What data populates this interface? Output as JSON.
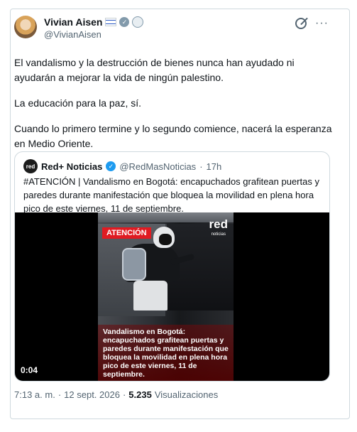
{
  "author": {
    "name": "Vivian Aisen",
    "handle": "@VivianAisen"
  },
  "tweet": {
    "paragraphs": [
      "El vandalismo y la destrucción de bienes nunca han ayudado ni ayudarán a mejorar la vida de ningún palestino.",
      "La educación para la paz, sí.",
      "Cuando lo primero termine y lo segundo comience, nacerá la esperanza en Medio Oriente."
    ]
  },
  "quote": {
    "logo_text": "red",
    "name": "Red+ Noticias",
    "handle": "@RedMasNoticias",
    "separator": "·",
    "time": "17h",
    "text": "#ATENCIÓN | Vandalismo en Bogotá: encapuchados grafitean puertas y paredes durante manifestación que bloquea la movilidad en plena hora pico de este viernes, 11 de septiembre.",
    "video": {
      "badge": "ATENCIÓN",
      "brand": "red",
      "brand_sub": "noticias",
      "caption": "Vandalismo en Bogotá: encapuchados grafitean puertas y paredes durante manifestación que bloquea la movilidad en plena hora pico de este viernes, 11 de septiembre.",
      "duration": "0:04"
    }
  },
  "meta": {
    "time": "7:13 a. m.",
    "separator1": "·",
    "date": "12 sept. 2026",
    "separator2": "·",
    "views_count": "5.235",
    "views_label": "Visualizaciones"
  },
  "icons": [
    "israel-flag-icon",
    "gray-check-badge-icon",
    "affiliate-badge-icon",
    "grok-icon",
    "more-icon",
    "verified-badge-icon"
  ],
  "colors": {
    "accent": "#1d9bf0",
    "secondary_text": "#536471",
    "border": "#cfd9de",
    "alert_red": "#e01b22"
  }
}
